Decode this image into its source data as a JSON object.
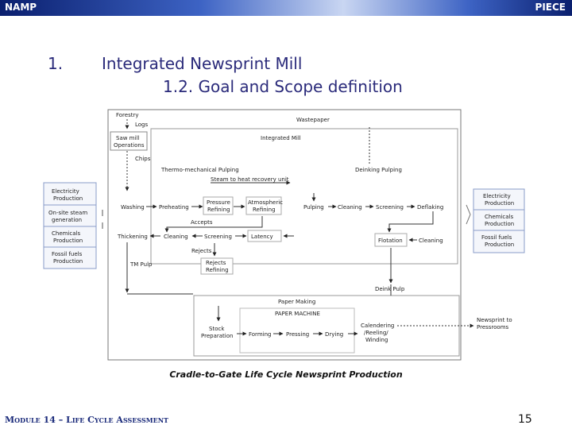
{
  "header": {
    "left": "NAMP",
    "right": "PIECE"
  },
  "heading": {
    "number": "1.",
    "title": "Integrated Newsprint Mill",
    "subtitle": "1.2. Goal and Scope definition"
  },
  "diagram": {
    "forestry": "Forestry",
    "logs": "Logs",
    "sawmill1": "Saw mill",
    "sawmill2": "Operations",
    "chips": "Chips",
    "wastepaper": "Wastepaper",
    "integrated_mill": "Integrated Mill",
    "tmp_title": "Thermo-mechanical Pulping",
    "steam": "Steam to heat recovery unit",
    "deinking_title": "Deinking Pulping",
    "washing": "Washing",
    "preheating": "Preheating",
    "pressure1": "Pressure",
    "pressure2": "Refining",
    "atmos1": "Atmospheric",
    "atmos2": "Refining",
    "accepts": "Accepts",
    "thickening": "Thickening",
    "cleaning": "Cleaning",
    "screening": "Screening",
    "latency": "Latency",
    "rejects": "Rejects",
    "rejref1": "Rejects",
    "rejref2": "Refining",
    "tmp_pulp": "TM Pulp",
    "pulping": "Pulping",
    "clean2": "Cleaning",
    "screen2": "Screening",
    "deflaking": "Deflaking",
    "flotation": "Flotation",
    "clean3": "Cleaning",
    "deink_pulp": "Deink Pulp",
    "left_inputs": [
      [
        "Electricity",
        "Production"
      ],
      [
        "On-site steam",
        "generation"
      ],
      [
        "Chemicals",
        "Production"
      ],
      [
        "Fossil fuels",
        "Production"
      ]
    ],
    "right_inputs": [
      [
        "Electricity",
        "Production"
      ],
      [
        "Chemicals",
        "Production"
      ],
      [
        "Fossil fuels",
        "Production"
      ]
    ],
    "papermaking": "Paper Making",
    "papermachine": "PAPER MACHINE",
    "stock1": "Stock",
    "stock2": "Preparation",
    "forming": "Forming",
    "pressing": "Pressing",
    "drying": "Drying",
    "cal1": "Calendering",
    "cal2": "/Reeling/",
    "cal3": "Winding",
    "newsprint1": "Newsprint to",
    "newsprint2": "Pressrooms"
  },
  "caption": "Cradle-to-Gate Life Cycle Newsprint Production",
  "footer": {
    "module": "Module 14 – Life Cycle Assessment",
    "page": "15"
  },
  "colors": {
    "header_dark": "#0a1f6e",
    "header_light": "#c9d6f2",
    "heading": "#2a2a7a"
  }
}
